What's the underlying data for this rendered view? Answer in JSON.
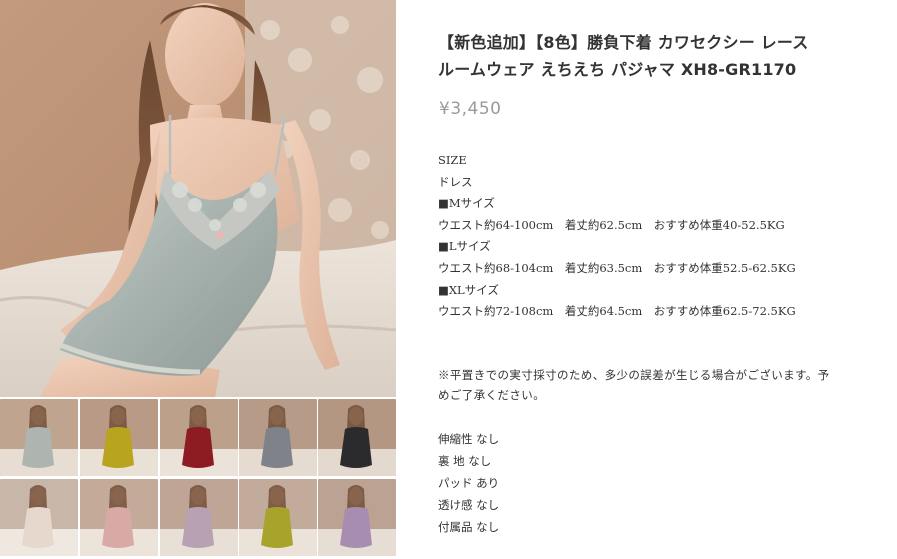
{
  "product": {
    "title_line1": "【新色追加】【8色】勝負下着 カワセクシー レース",
    "title_line2": "ルームウェア えちえち パジャマ XH8-GR1170",
    "price": "¥3,450"
  },
  "gallery": {
    "main_color": "#a9b4b0",
    "thumbnails": [
      {
        "color_name": "silver-gray",
        "swatch": "#aeb5b1"
      },
      {
        "color_name": "mustard",
        "swatch": "#b9a41f"
      },
      {
        "color_name": "wine-red",
        "swatch": "#8c1b22"
      },
      {
        "color_name": "steel-gray",
        "swatch": "#7f8289"
      },
      {
        "color_name": "black",
        "swatch": "#2b2b2e"
      },
      {
        "color_name": "champagne",
        "swatch": "#e6d8cc"
      },
      {
        "color_name": "pink",
        "swatch": "#d9a9a6"
      },
      {
        "color_name": "lilac",
        "swatch": "#b7a1b3"
      },
      {
        "color_name": "olive-yellow",
        "swatch": "#a7a32b"
      },
      {
        "color_name": "lavender",
        "swatch": "#a78db0"
      }
    ]
  },
  "description": {
    "lines": [
      "SIZE",
      "ドレス",
      "■Mサイズ",
      "ウエスト約64-100cm　着丈約62.5cm　おすすめ体重40-52.5KG",
      "■Lサイズ",
      "ウエスト約68-104cm　着丈約63.5cm　おすすめ体重52.5-62.5KG",
      "■XLサイズ",
      "ウエスト約72-108cm　着丈約64.5cm　おすすめ体重62.5‐72.5KG"
    ],
    "note_line1": "※平置きでの実寸採寸のため、多少の誤差が生じる場合がございます。予",
    "note_line2": "めご了承ください。",
    "properties": [
      "伸縮性 なし",
      "裏 地 なし",
      "パッド あり",
      "透け感 なし",
      "付属品 なし"
    ]
  }
}
